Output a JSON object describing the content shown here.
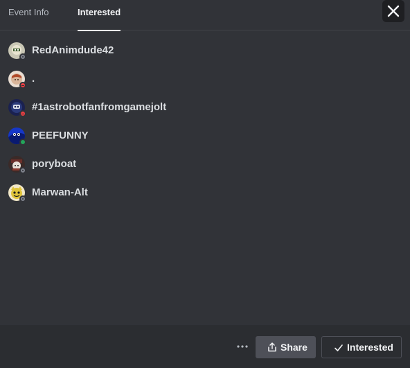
{
  "tabs": [
    {
      "label": "Event Info",
      "active": false
    },
    {
      "label": "Interested",
      "active": true
    }
  ],
  "close_icon": "close-icon",
  "users": [
    {
      "name": "RedAnimdude42",
      "status": "offline",
      "avatar_color": "#c9c7b5"
    },
    {
      "name": ".",
      "status": "dnd",
      "avatar_color": "#d8c4b6"
    },
    {
      "name": "#1astrobotfanfromgamejolt",
      "status": "dnd",
      "avatar_color": "#2b3a7a"
    },
    {
      "name": "PEEFUNNY",
      "status": "online",
      "avatar_color": "#1637c8"
    },
    {
      "name": "poryboat",
      "status": "offline",
      "avatar_color": "#6b2f2a"
    },
    {
      "name": "Marwan-Alt",
      "status": "offline",
      "avatar_color": "#e0c43a"
    }
  ],
  "footer": {
    "more_icon": "ellipsis-icon",
    "share_label": "Share",
    "share_icon": "share-icon",
    "interested_label": "Interested",
    "interested_icon": "checkmark-icon"
  },
  "colors": {
    "background": "#313338",
    "footer": "#2b2d31",
    "status_online": "#23a55a",
    "status_dnd": "#f23f43",
    "status_offline": "#80848e"
  }
}
